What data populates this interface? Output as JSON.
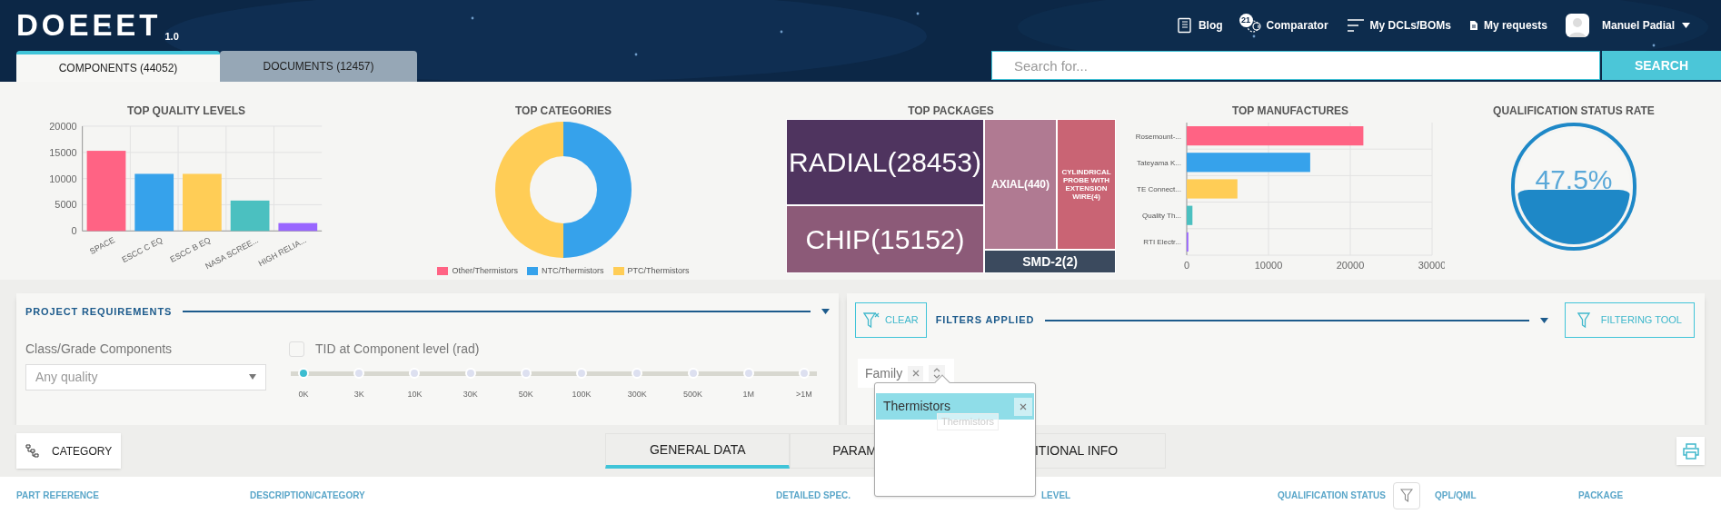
{
  "header": {
    "logo": "DOEEET",
    "version": "1.0",
    "nav": [
      {
        "kind": "blog",
        "label": "Blog"
      },
      {
        "kind": "comparator",
        "label": "Comparator",
        "badge": "21"
      },
      {
        "kind": "lists",
        "label": "My DCLs/BOMs"
      },
      {
        "kind": "requests",
        "label": "My requests"
      }
    ],
    "user": {
      "name": "Manuel Padial"
    }
  },
  "tabs": [
    {
      "label": "COMPONENTS (44052)",
      "selected": true
    },
    {
      "label": "DOCUMENTS (12457)",
      "selected": false
    }
  ],
  "search": {
    "placeholder": "Search for...",
    "button": "SEARCH"
  },
  "quality_levels": {
    "title": "TOP QUALITY LEVELS",
    "chart_data": {
      "type": "bar",
      "grid": true,
      "categories": [
        "SPACE",
        "ESCC C EQ",
        "ESCC B EQ",
        "NASA SCREE...",
        "HIGH RELIA..."
      ],
      "ylim": [
        0,
        20000
      ],
      "yticks": [
        0,
        5000,
        10000,
        15000,
        20000
      ],
      "values": [
        15300,
        10900,
        10900,
        5800,
        1500
      ],
      "colors": [
        "#ff6384",
        "#36a2eb",
        "#ffcd56",
        "#4bc0c0",
        "#9966ff"
      ]
    }
  },
  "categories": {
    "title": "TOP CATEGORIES",
    "chart_data": {
      "type": "donut",
      "categories": [
        "Other/Thermistors",
        "NTC/Thermistors",
        "PTC/Thermistors"
      ],
      "legend": "bottom",
      "values": [
        0,
        50,
        50
      ],
      "colors": [
        "#ff6384",
        "#36a2eb",
        "#ffcd56"
      ]
    }
  },
  "packages": {
    "title": "TOP PACKAGES",
    "blocks": [
      {
        "label": "RADIAL(28453)",
        "color": "#4f345f"
      },
      {
        "label": "CHIP(15152)",
        "color": "#8c5a78"
      },
      {
        "label": "AXIAL(440)",
        "color": "#b07a92"
      },
      {
        "label": "CYLINDRICAL PROBE WITH EXTENSION WIRE(4)",
        "color": "#c96474"
      },
      {
        "label": "SMD-2(2)",
        "color": "#3b4a5e"
      }
    ]
  },
  "manufactures": {
    "title": "TOP MANUFACTURES",
    "chart_data": {
      "type": "bar",
      "orientation": "horizontal",
      "grid": true,
      "categories": [
        "Rosemount-...",
        "Tateyama K...",
        "TE Connect...",
        "Quality Th...",
        "RTI Electr..."
      ],
      "xlim": [
        0,
        30000
      ],
      "xticks": [
        0,
        10000,
        20000,
        30000
      ],
      "values": [
        21600,
        15100,
        6200,
        700,
        200
      ],
      "colors": [
        "#ff6384",
        "#36a2eb",
        "#ffcd56",
        "#4bc0c0",
        "#9966ff"
      ]
    }
  },
  "qualification": {
    "title": "QUALIFICATION STATUS RATE",
    "value": "47.5%",
    "level": 0.475
  },
  "project_requirements": {
    "title": "PROJECT REQUIREMENTS",
    "class_label": "Class/Grade Components",
    "class_value": "Any quality",
    "tid": {
      "label": "TID at Component level (rad)",
      "checked": false,
      "ticks": [
        {
          "label": "0K",
          "selected": true
        },
        {
          "label": "3K",
          "selected": false
        },
        {
          "label": "10K",
          "selected": false
        },
        {
          "label": "30K",
          "selected": false
        },
        {
          "label": "50K",
          "selected": false
        },
        {
          "label": "100K",
          "selected": false
        },
        {
          "label": "300K",
          "selected": false
        },
        {
          "label": "500K",
          "selected": false
        },
        {
          "label": "1M",
          "selected": false
        },
        {
          "label": ">1M",
          "selected": false
        }
      ]
    }
  },
  "filters": {
    "clear": "CLEAR",
    "title": "FILTERS APPLIED",
    "tool": "FILTERING TOOL",
    "chips": [
      {
        "label": "Family"
      }
    ]
  },
  "popup": {
    "items": [
      {
        "label": "Thermistors",
        "selected": true
      }
    ],
    "drag_ghost": "Thermistors"
  },
  "category_button": "CATEGORY",
  "data_tabs": [
    {
      "label": "GENERAL DATA",
      "selected": true
    },
    {
      "label": "PARAM",
      "selected": false
    },
    {
      "label": "ITIONAL INFO",
      "selected": false
    }
  ],
  "table": {
    "columns": [
      "PART REFERENCE",
      "DESCRIPTION/CATEGORY",
      "DETAILED SPEC.",
      "LEVEL",
      "QUALIFICATION STATUS",
      "QPL/QML",
      "PACKAGE"
    ]
  }
}
